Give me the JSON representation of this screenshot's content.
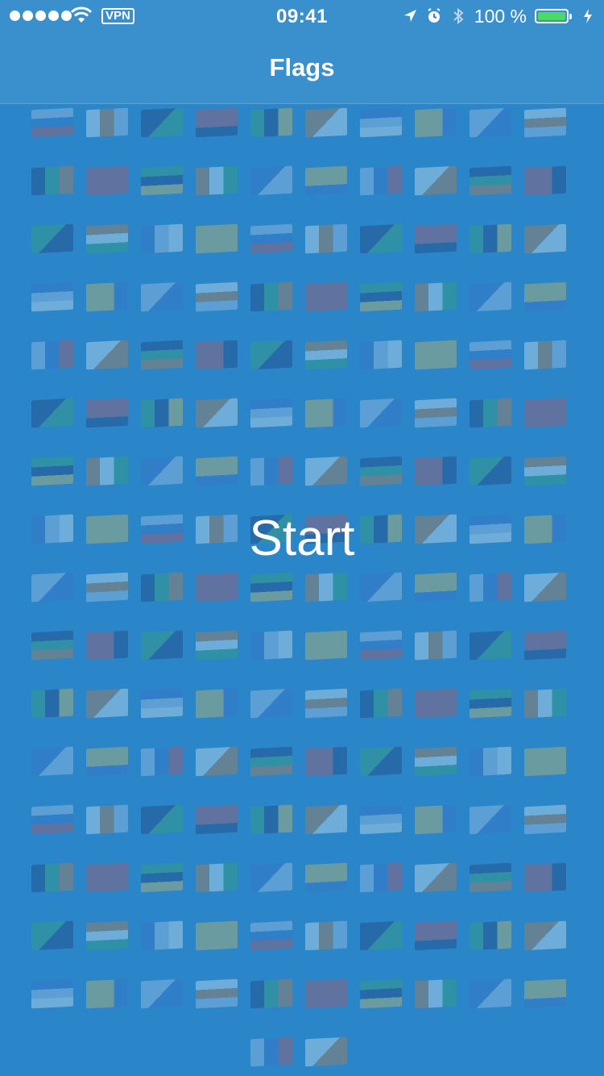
{
  "status_bar": {
    "vpn_label": "VPN",
    "time": "09:41",
    "battery_percent": "100 %",
    "battery_level": 1.0,
    "icons": [
      "signal-dots",
      "wifi-icon",
      "location-arrow-icon",
      "alarm-clock-icon",
      "bluetooth-icon",
      "battery-icon",
      "charging-bolt-icon"
    ]
  },
  "nav": {
    "title": "Flags"
  },
  "main": {
    "start_label": "Start"
  },
  "flags": {
    "count": 162,
    "palette": [
      "#c8d4ec",
      "#d24a4a",
      "#3d6fc8",
      "#ffffff",
      "#3da55a",
      "#f0c84a",
      "#1f2e6b",
      "#e07a2a"
    ]
  },
  "colors": {
    "background": "#2a86c8",
    "nav_background": "#3a8fcd",
    "text": "#ffffff",
    "battery_fill": "#4cd964"
  }
}
